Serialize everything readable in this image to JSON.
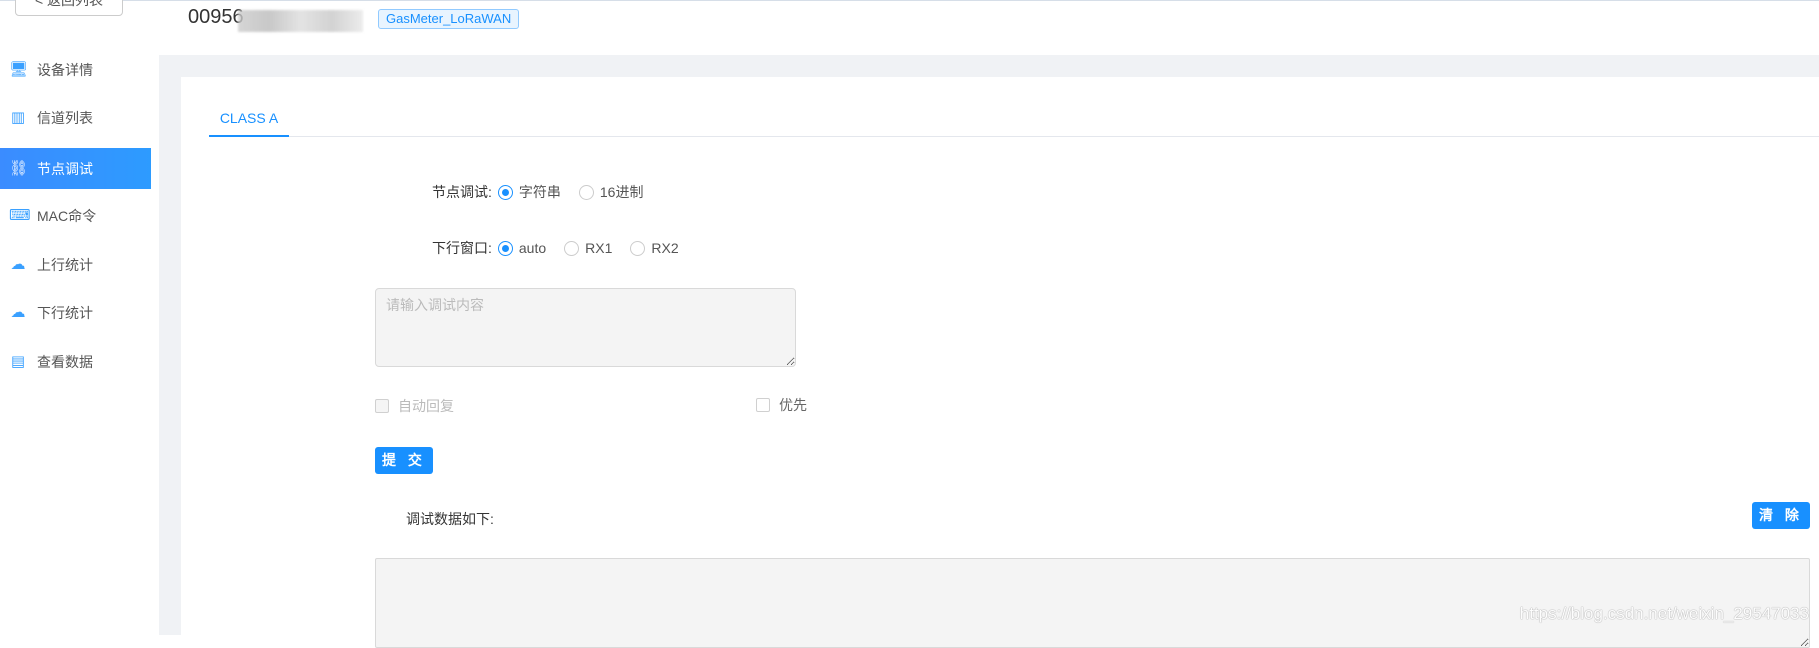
{
  "header": {
    "back_label": "< 返回列表",
    "device_id": "00956",
    "device_type_tag": "GasMeter_LoRaWAN"
  },
  "sidebar": {
    "items": [
      {
        "label": "设备详情",
        "icon": "monitor-icon",
        "active": false
      },
      {
        "label": "信道列表",
        "icon": "bar-chart-icon",
        "active": false
      },
      {
        "label": "节点调试",
        "icon": "node-debug-icon",
        "active": true
      },
      {
        "label": "MAC命令",
        "icon": "code-monitor-icon",
        "active": false
      },
      {
        "label": "上行统计",
        "icon": "cloud-upload-icon",
        "active": false
      },
      {
        "label": "下行统计",
        "icon": "cloud-download-icon",
        "active": false
      },
      {
        "label": "查看数据",
        "icon": "data-chart-icon",
        "active": false
      }
    ]
  },
  "tabs": [
    {
      "label": "CLASS A",
      "active": true
    }
  ],
  "form": {
    "debug_mode": {
      "label": "节点调试:",
      "options": [
        "字符串",
        "16进制"
      ],
      "selected": "字符串"
    },
    "downlink_window": {
      "label": "下行窗口:",
      "options": [
        "auto",
        "RX1",
        "RX2"
      ],
      "selected": "auto"
    },
    "content_placeholder": "请输入调试内容",
    "auto_reply_label": "自动回复",
    "priority_label": "优先",
    "submit_label": "提 交"
  },
  "output": {
    "label": "调试数据如下:",
    "clear_label": "清 除"
  },
  "watermark": "https://blog.csdn.net/weixin_29547033",
  "colors": {
    "accent": "#1890ff",
    "background": "#f0f2f5"
  }
}
